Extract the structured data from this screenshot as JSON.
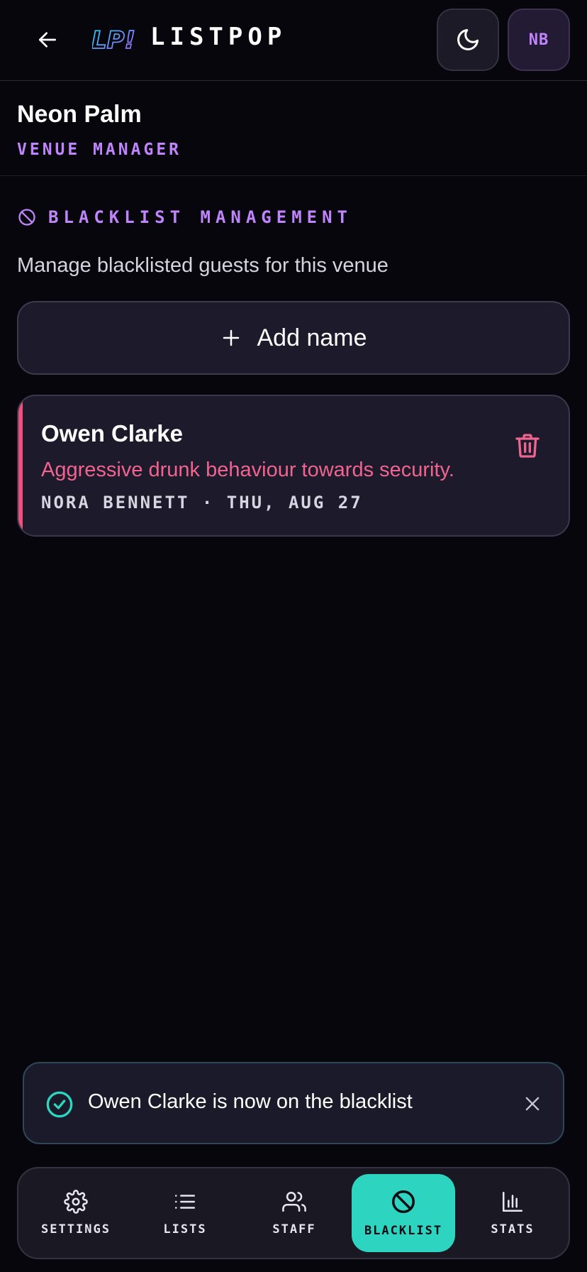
{
  "header": {
    "app_title": "LISTPOP",
    "logo_text": "LP!",
    "avatar_initials": "NB"
  },
  "venue": {
    "name": "Neon Palm",
    "role": "VENUE MANAGER"
  },
  "section": {
    "title": "BLACKLIST MANAGEMENT",
    "description": "Manage blacklisted guests for this venue",
    "add_label": "Add name"
  },
  "blacklist": [
    {
      "name": "Owen Clarke",
      "reason": "Aggressive drunk behaviour towards security.",
      "meta": "NORA BENNETT · THU, AUG 27"
    }
  ],
  "toast": {
    "message": "Owen Clarke is now on the blacklist"
  },
  "nav": {
    "items": [
      {
        "label": "SETTINGS",
        "icon": "gear-icon"
      },
      {
        "label": "LISTS",
        "icon": "list-icon"
      },
      {
        "label": "STAFF",
        "icon": "users-icon"
      },
      {
        "label": "BLACKLIST",
        "icon": "ban-icon",
        "active": true
      },
      {
        "label": "STATS",
        "icon": "bar-chart-icon"
      }
    ]
  },
  "colors": {
    "accent_purple": "#c084fc",
    "accent_teal": "#2dd4bf",
    "danger_pink": "#f0507f",
    "background": "#07060c"
  }
}
